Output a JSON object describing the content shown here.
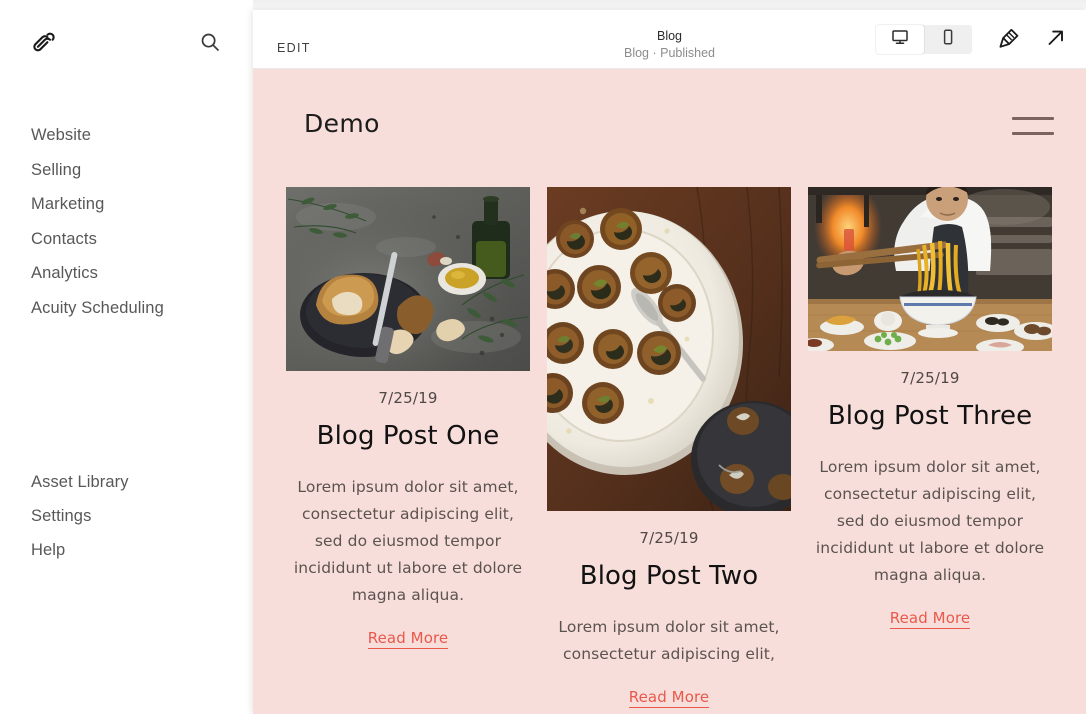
{
  "sidebar": {
    "logo_icon": "squarespace-logo-icon",
    "search_icon": "search-icon",
    "primary_items": [
      {
        "label": "Website"
      },
      {
        "label": "Selling"
      },
      {
        "label": "Marketing"
      },
      {
        "label": "Contacts"
      },
      {
        "label": "Analytics"
      },
      {
        "label": "Acuity Scheduling"
      }
    ],
    "secondary_items": [
      {
        "label": "Asset Library"
      },
      {
        "label": "Settings"
      },
      {
        "label": "Help"
      }
    ]
  },
  "toolbar": {
    "edit_label": "EDIT",
    "page_title": "Blog",
    "page_status": "Blog · Published",
    "view_toggle": {
      "desktop": {
        "icon": "desktop-monitor-icon",
        "selected": true
      },
      "mobile": {
        "icon": "mobile-phone-icon",
        "selected": false
      }
    },
    "style_icon": "paint-brush-icon",
    "open_icon": "external-link-arrow-icon"
  },
  "site": {
    "background_color": "#F8DEDA",
    "logo_text": "Demo",
    "menu_icon": "hamburger-menu-icon",
    "link_color": "#E8594C",
    "posts": [
      {
        "image_alt": "rustic-bread-olive-oil-photo",
        "date": "7/25/19",
        "title": "Blog Post One",
        "excerpt": "Lorem ipsum dolor sit amet, consectetur adipiscing elit, sed do eiusmod tempor incididunt ut labore et dolore magna aliqua.",
        "read_more": "Read More"
      },
      {
        "image_alt": "escargot-white-plate-photo",
        "date": "7/25/19",
        "title": "Blog Post Two",
        "excerpt": "Lorem ipsum dolor sit amet, consectetur adipiscing elit,",
        "read_more": "Read More"
      },
      {
        "image_alt": "chef-lifting-noodles-photo",
        "date": "7/25/19",
        "title": "Blog Post Three",
        "excerpt": "Lorem ipsum dolor sit amet, consectetur adipiscing elit, sed do eiusmod tempor incididunt ut labore et dolore magna aliqua.",
        "read_more": "Read More"
      }
    ]
  }
}
